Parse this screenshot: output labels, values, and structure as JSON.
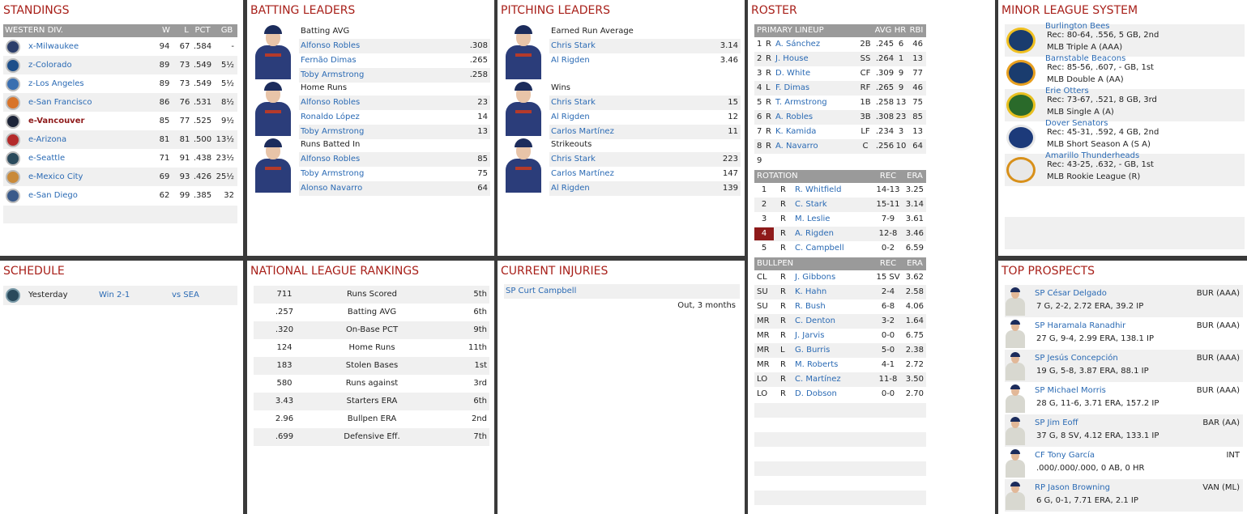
{
  "standings": {
    "title": "STANDINGS",
    "division": "WESTERN DIV.",
    "cols": [
      "W",
      "L",
      "PCT",
      "GB"
    ],
    "teams": [
      {
        "name": "x-Milwaukee",
        "w": "94",
        "l": "67",
        "pct": ".584",
        "gb": "-",
        "color": "#2c3e6a"
      },
      {
        "name": "z-Colorado",
        "w": "89",
        "l": "73",
        "pct": ".549",
        "gb": "5½",
        "color": "#1e4f8a"
      },
      {
        "name": "z-Los Angeles",
        "w": "89",
        "l": "73",
        "pct": ".549",
        "gb": "5½",
        "color": "#3a6fb0"
      },
      {
        "name": "e-San Francisco",
        "w": "86",
        "l": "76",
        "pct": ".531",
        "gb": "8½",
        "color": "#d8742a"
      },
      {
        "name": "e-Vancouver",
        "w": "85",
        "l": "77",
        "pct": ".525",
        "gb": "9½",
        "color": "#1c2438",
        "highlight": true
      },
      {
        "name": "e-Arizona",
        "w": "81",
        "l": "81",
        "pct": ".500",
        "gb": "13½",
        "color": "#b42a2a"
      },
      {
        "name": "e-Seattle",
        "w": "71",
        "l": "91",
        "pct": ".438",
        "gb": "23½",
        "color": "#2a4a5c"
      },
      {
        "name": "e-Mexico City",
        "w": "69",
        "l": "93",
        "pct": ".426",
        "gb": "25½",
        "color": "#c98a3a"
      },
      {
        "name": "e-San Diego",
        "w": "62",
        "l": "99",
        "pct": ".385",
        "gb": "32",
        "color": "#3a5a8a"
      }
    ]
  },
  "batting": {
    "title": "BATTING LEADERS",
    "groups": [
      {
        "label": "Batting AVG",
        "rows": [
          {
            "name": "Alfonso Robles",
            "val": ".308"
          },
          {
            "name": "Fernão Dimas",
            "val": ".265"
          },
          {
            "name": "Toby Armstrong",
            "val": ".258"
          }
        ]
      },
      {
        "label": "Home Runs",
        "rows": [
          {
            "name": "Alfonso Robles",
            "val": "23"
          },
          {
            "name": "Ronaldo López",
            "val": "14"
          },
          {
            "name": "Toby Armstrong",
            "val": "13"
          }
        ]
      },
      {
        "label": "Runs Batted In",
        "rows": [
          {
            "name": "Alfonso Robles",
            "val": "85"
          },
          {
            "name": "Toby Armstrong",
            "val": "75"
          },
          {
            "name": "Alonso Navarro",
            "val": "64"
          }
        ]
      }
    ]
  },
  "pitching": {
    "title": "PITCHING LEADERS",
    "groups": [
      {
        "label": "Earned Run Average",
        "rows": [
          {
            "name": "Chris Stark",
            "val": "3.14"
          },
          {
            "name": "Al Rigden",
            "val": "3.46"
          }
        ]
      },
      {
        "label": "Wins",
        "rows": [
          {
            "name": "Chris Stark",
            "val": "15"
          },
          {
            "name": "Al Rigden",
            "val": "12"
          },
          {
            "name": "Carlos Martínez",
            "val": "11"
          }
        ]
      },
      {
        "label": "Strikeouts",
        "rows": [
          {
            "name": "Chris Stark",
            "val": "223"
          },
          {
            "name": "Carlos Martínez",
            "val": "147"
          },
          {
            "name": "Al Rigden",
            "val": "139"
          }
        ]
      }
    ]
  },
  "roster": {
    "title": "ROSTER",
    "lineup_header": [
      "PRIMARY LINEUP",
      "AVG",
      "HR",
      "RBI"
    ],
    "lineup": [
      {
        "n": "1",
        "h": "R",
        "name": "A. Sánchez",
        "pos": "2B",
        "avg": ".245",
        "hr": "6",
        "rbi": "46"
      },
      {
        "n": "2",
        "h": "R",
        "name": "J. House",
        "pos": "SS",
        "avg": ".264",
        "hr": "1",
        "rbi": "13"
      },
      {
        "n": "3",
        "h": "R",
        "name": "D. White",
        "pos": "CF",
        "avg": ".309",
        "hr": "9",
        "rbi": "77"
      },
      {
        "n": "4",
        "h": "L",
        "name": "F. Dimas",
        "pos": "RF",
        "avg": ".265",
        "hr": "9",
        "rbi": "46"
      },
      {
        "n": "5",
        "h": "R",
        "name": "T. Armstrong",
        "pos": "1B",
        "avg": ".258",
        "hr": "13",
        "rbi": "75"
      },
      {
        "n": "6",
        "h": "R",
        "name": "A. Robles",
        "pos": "3B",
        "avg": ".308",
        "hr": "23",
        "rbi": "85"
      },
      {
        "n": "7",
        "h": "R",
        "name": "K. Kamida",
        "pos": "LF",
        "avg": ".234",
        "hr": "3",
        "rbi": "13"
      },
      {
        "n": "8",
        "h": "R",
        "name": "A. Navarro",
        "pos": "C",
        "avg": ".256",
        "hr": "10",
        "rbi": "64"
      },
      {
        "n": "9",
        "h": "",
        "name": "",
        "pos": "",
        "avg": "",
        "hr": "",
        "rbi": ""
      }
    ],
    "rotation_header": [
      "ROTATION",
      "REC",
      "ERA"
    ],
    "rotation": [
      {
        "n": "1",
        "h": "R",
        "name": "R. Whitfield",
        "rec": "14-13",
        "era": "3.25"
      },
      {
        "n": "2",
        "h": "R",
        "name": "C. Stark",
        "rec": "15-11",
        "era": "3.14"
      },
      {
        "n": "3",
        "h": "R",
        "name": "M. Leslie",
        "rec": "7-9",
        "era": "3.61"
      },
      {
        "n": "4",
        "h": "R",
        "name": "A. Rigden",
        "rec": "12-8",
        "era": "3.46",
        "badge": true
      },
      {
        "n": "5",
        "h": "R",
        "name": "C. Campbell",
        "rec": "0-2",
        "era": "6.59"
      }
    ],
    "bullpen_header": [
      "BULLPEN",
      "REC",
      "ERA"
    ],
    "bullpen": [
      {
        "role": "CL",
        "h": "R",
        "name": "J. Gibbons",
        "rec": "15 SV",
        "era": "3.62"
      },
      {
        "role": "SU",
        "h": "R",
        "name": "K. Hahn",
        "rec": "2-4",
        "era": "2.58"
      },
      {
        "role": "SU",
        "h": "R",
        "name": "R. Bush",
        "rec": "6-8",
        "era": "4.06"
      },
      {
        "role": "MR",
        "h": "R",
        "name": "C. Denton",
        "rec": "3-2",
        "era": "1.64"
      },
      {
        "role": "MR",
        "h": "R",
        "name": "J. Jarvis",
        "rec": "0-0",
        "era": "6.75"
      },
      {
        "role": "MR",
        "h": "L",
        "name": "G. Burris",
        "rec": "5-0",
        "era": "2.38"
      },
      {
        "role": "MR",
        "h": "R",
        "name": "M. Roberts",
        "rec": "4-1",
        "era": "2.72"
      },
      {
        "role": "LO",
        "h": "R",
        "name": "C. Martínez",
        "rec": "11-8",
        "era": "3.50"
      },
      {
        "role": "LO",
        "h": "R",
        "name": "D. Dobson",
        "rec": "0-0",
        "era": "2.70"
      }
    ]
  },
  "minors": {
    "title": "MINOR LEAGUE SYSTEM",
    "teams": [
      {
        "name": "Burlington Bees",
        "rec": "Rec: 80-64, .556, 5 GB, 2nd",
        "level": "MLB Triple A (AAA)"
      },
      {
        "name": "Barnstable Beacons",
        "rec": "Rec: 85-56, .607, - GB, 1st",
        "level": "MLB Double A (AA)"
      },
      {
        "name": "Erie Otters",
        "rec": "Rec: 73-67, .521, 8 GB, 3rd",
        "level": "MLB Single A (A)"
      },
      {
        "name": "Dover Senators",
        "rec": "Rec: 45-31, .592, 4 GB, 2nd",
        "level": "MLB Short Season A (S A)"
      },
      {
        "name": "Amarillo Thunderheads",
        "rec": "Rec: 43-25, .632, - GB, 1st",
        "level": "MLB Rookie League (R)"
      }
    ]
  },
  "schedule": {
    "title": "SCHEDULE",
    "day": "Yesterday",
    "result": "Win 2-1",
    "opp": "vs SEA"
  },
  "rankings": {
    "title": "NATIONAL LEAGUE RANKINGS",
    "rows": [
      {
        "v": "711",
        "l": "Runs Scored",
        "r": "5th"
      },
      {
        "v": ".257",
        "l": "Batting AVG",
        "r": "6th"
      },
      {
        "v": ".320",
        "l": "On-Base PCT",
        "r": "9th"
      },
      {
        "v": "124",
        "l": "Home Runs",
        "r": "11th"
      },
      {
        "v": "183",
        "l": "Stolen Bases",
        "r": "1st"
      },
      {
        "v": "580",
        "l": "Runs against",
        "r": "3rd"
      },
      {
        "v": "3.43",
        "l": "Starters ERA",
        "r": "6th"
      },
      {
        "v": "2.96",
        "l": "Bullpen ERA",
        "r": "2nd"
      },
      {
        "v": ".699",
        "l": "Defensive Eff.",
        "r": "7th"
      }
    ]
  },
  "injuries": {
    "title": "CURRENT INJURIES",
    "player": "SP Curt Campbell",
    "status": "Out, 3 months"
  },
  "prospects": {
    "title": "TOP PROSPECTS",
    "rows": [
      {
        "name": "SP César Delgado",
        "team": "BUR (AAA)",
        "line": "7 G, 2-2, 2.72 ERA, 39.2 IP"
      },
      {
        "name": "SP Haramala Ranadhir",
        "team": "BUR (AAA)",
        "line": "27 G, 9-4, 2.99 ERA, 138.1 IP"
      },
      {
        "name": "SP Jesús Concepción",
        "team": "BUR (AAA)",
        "line": "19 G, 5-8, 3.87 ERA, 88.1 IP"
      },
      {
        "name": "SP Michael Morris",
        "team": "BUR (AAA)",
        "line": "28 G, 11-6, 3.71 ERA, 157.2 IP"
      },
      {
        "name": "SP Jim Eoff",
        "team": "BAR (AA)",
        "line": "37 G, 8 SV, 4.12 ERA, 133.1 IP"
      },
      {
        "name": "CF Tony García",
        "team": "INT",
        "line": ".000/.000/.000, 0 AB, 0 HR"
      },
      {
        "name": "RP Jason Browning",
        "team": "VAN (ML)",
        "line": "6 G, 0-1, 7.71 ERA, 2.1 IP"
      }
    ]
  }
}
